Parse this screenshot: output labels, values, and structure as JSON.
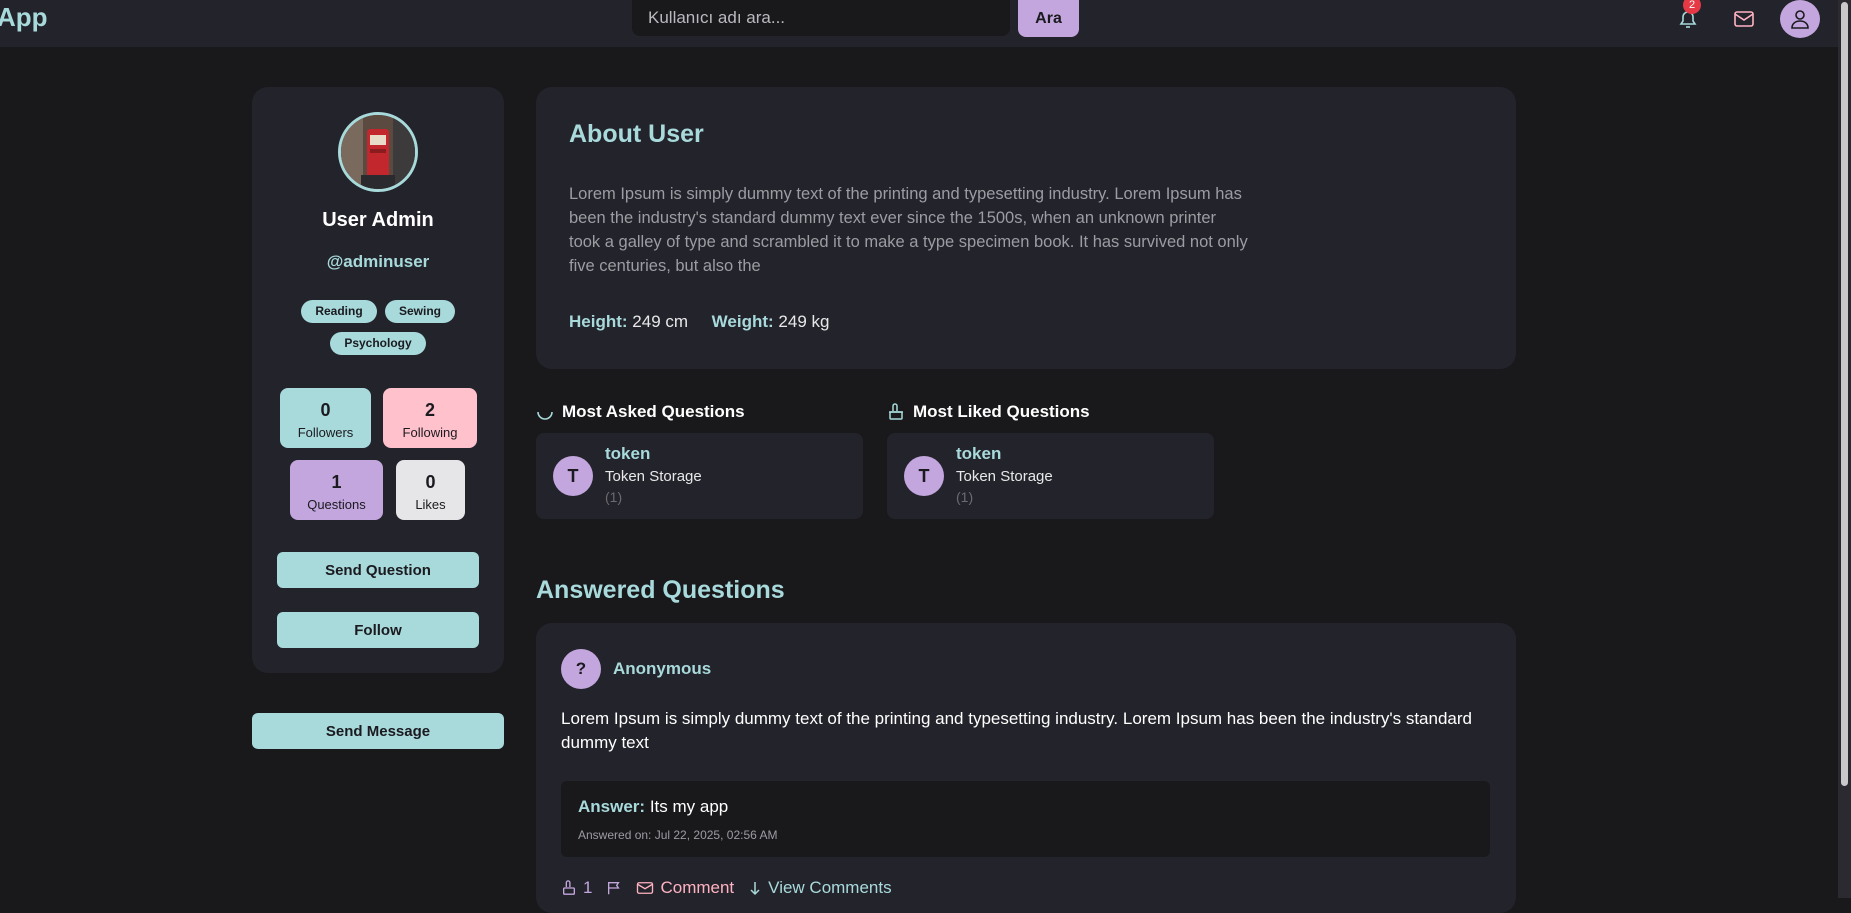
{
  "header": {
    "brand": "App",
    "search_placeholder": "Kullanıcı adı ara...",
    "search_button": "Ara",
    "notification_count": "2"
  },
  "profile": {
    "name": "User Admin",
    "handle": "@adminuser",
    "tags": [
      "Reading",
      "Sewing",
      "Psychology"
    ],
    "stats": {
      "followers": {
        "value": "0",
        "label": "Followers"
      },
      "following": {
        "value": "2",
        "label": "Following"
      },
      "questions": {
        "value": "1",
        "label": "Questions"
      },
      "likes": {
        "value": "0",
        "label": "Likes"
      }
    },
    "send_question": "Send Question",
    "follow": "Follow",
    "send_message": "Send Message"
  },
  "about": {
    "title": "About User",
    "text": "Lorem Ipsum is simply dummy text of the printing and typesetting industry. Lorem Ipsum has been the industry's standard dummy text ever since the 1500s, when an unknown printer took a galley of type and scrambled it to make a type specimen book. It has survived not only five centuries, but also the",
    "height_label": "Height:",
    "height_value": "249 cm",
    "weight_label": "Weight:",
    "weight_value": "249 kg"
  },
  "most_asked": {
    "title": "Most Asked Questions",
    "item": {
      "initial": "T",
      "title": "token",
      "subtitle": "Token Storage",
      "count": "(1)"
    }
  },
  "most_liked": {
    "title": "Most Liked Questions",
    "item": {
      "initial": "T",
      "title": "token",
      "subtitle": "Token Storage",
      "count": "(1)"
    }
  },
  "answered": {
    "title": "Answered Questions",
    "items": [
      {
        "avatar": "?",
        "author": "Anonymous",
        "question": "Lorem Ipsum is simply dummy text of the printing and typesetting industry. Lorem Ipsum has been the industry's standard dummy text",
        "answer_label": "Answer:",
        "answer": "Its my app",
        "answered_on": "Answered on: Jul 22, 2025, 02:56 AM",
        "like_count": "1",
        "comment_label": "Comment",
        "view_comments_label": "View Comments"
      }
    ]
  },
  "colors": {
    "accent_teal": "#a8dadc",
    "accent_purple": "#c3a6de",
    "accent_pink": "#ffc1cc",
    "badge_red": "#e53945",
    "background": "#19191c",
    "card": "#23232b"
  }
}
